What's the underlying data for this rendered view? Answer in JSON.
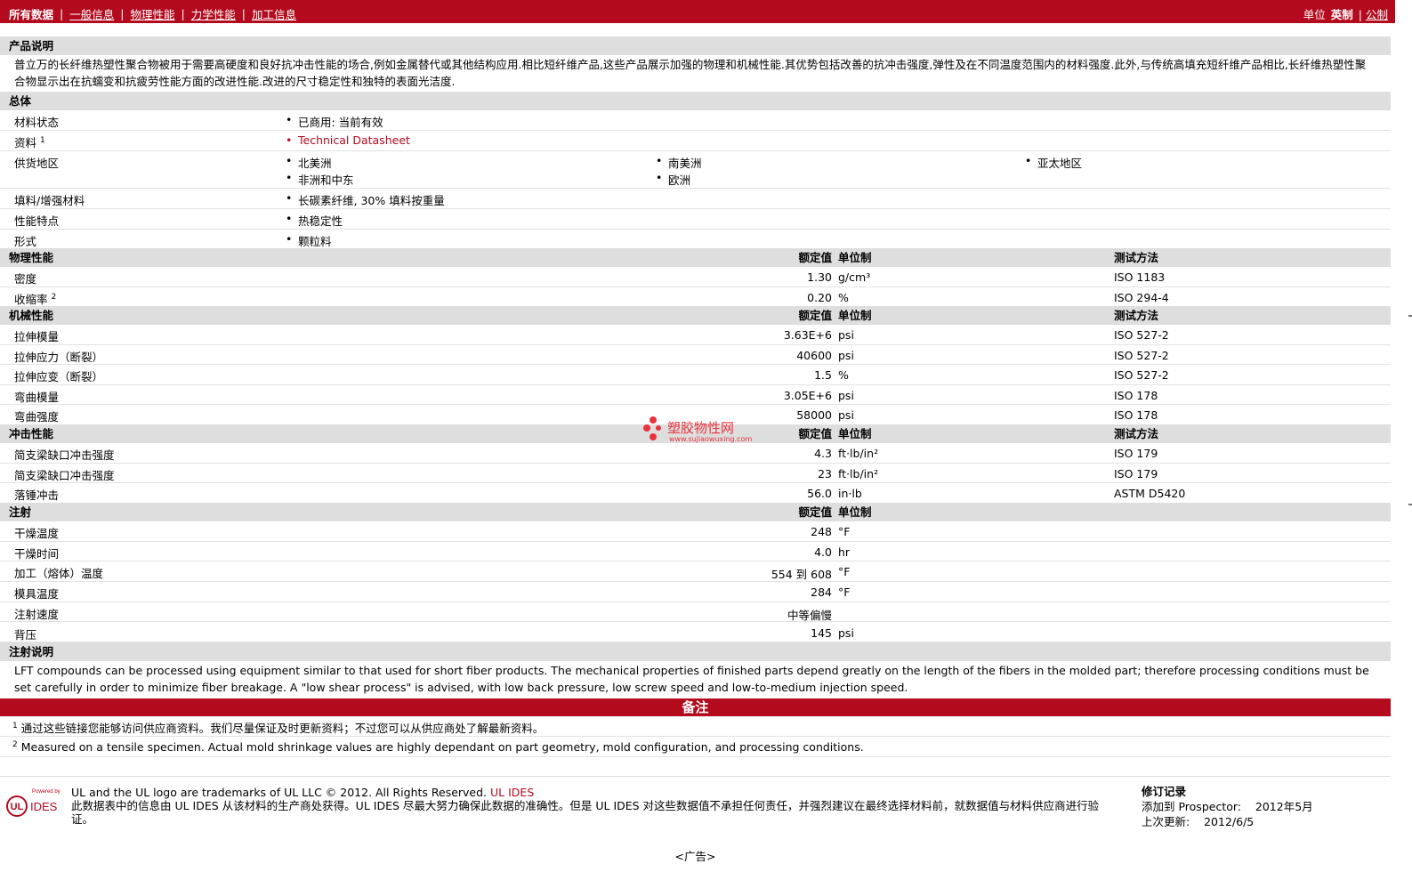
{
  "tabs": [
    "所有数据",
    "一般信息",
    "物理性能",
    "力学性能",
    "加工信息"
  ],
  "units": {
    "label": "单位",
    "current": "英制",
    "alternate": "公制"
  },
  "product": {
    "heading": "产品说明",
    "text": "普立万的长纤维热塑性聚合物被用于需要高硬度和良好抗冲击性能的场合,例如金属替代或其他结构应用.相比短纤维产品,这些产品展示加强的物理和机械性能.其优势包括改善的抗冲击强度,弹性及在不同温度范围内的材料强度.此外,与传统高填充短纤维产品相比,长纤维热塑性聚合物显示出在抗蠕变和抗疲劳性能方面的改进性能.改进的尺寸稳定性和独特的表面光洁度."
  },
  "general": {
    "heading": "总体",
    "status_label": "材料状态",
    "status_value": "已商用: 当前有效",
    "resource_label": "资料",
    "resource_sup": "1",
    "resource_value": "Technical Datasheet",
    "region_label": "供货地区",
    "regions": [
      "北美洲",
      "南美洲",
      "亚太地区",
      "非洲和中东",
      "欧洲"
    ],
    "filler_label": "填料/增强材料",
    "filler_value": "长碳素纤维, 30% 填料按重量",
    "feature_label": "性能特点",
    "feature_value": "热稳定性",
    "form_label": "形式",
    "form_value": "颗粒料"
  },
  "col_headers": {
    "value": "额定值",
    "unit": "单位制",
    "method": "测试方法"
  },
  "physical": {
    "heading": "物理性能",
    "rows": [
      {
        "label": "密度",
        "sup": "",
        "value": "1.30",
        "unit": "g/cm³",
        "method": "ISO 1183"
      },
      {
        "label": "收缩率",
        "sup": "2",
        "value": "0.20",
        "unit": "%",
        "method": "ISO 294-4"
      }
    ]
  },
  "mechanical": {
    "heading": "机械性能",
    "rows": [
      {
        "label": "拉伸模量",
        "value": "3.63E+6",
        "unit": "psi",
        "method": "ISO 527-2"
      },
      {
        "label": "拉伸应力（断裂）",
        "value": "40600",
        "unit": "psi",
        "method": "ISO 527-2"
      },
      {
        "label": "拉伸应变（断裂）",
        "value": "1.5",
        "unit": "%",
        "method": "ISO 527-2"
      },
      {
        "label": "弯曲模量",
        "value": "3.05E+6",
        "unit": "psi",
        "method": "ISO 178"
      },
      {
        "label": "弯曲强度",
        "value": "58000",
        "unit": "psi",
        "method": "ISO 178"
      }
    ]
  },
  "impact": {
    "heading": "冲击性能",
    "rows": [
      {
        "label": "简支梁缺口冲击强度",
        "value": "4.3",
        "unit": "ft·lb/in²",
        "method": "ISO 179"
      },
      {
        "label": "简支梁缺口冲击强度",
        "value": "23",
        "unit": "ft·lb/in²",
        "method": "ISO 179"
      },
      {
        "label": "落锤冲击",
        "value": "56.0",
        "unit": "in·lb",
        "method": "ASTM D5420"
      }
    ]
  },
  "injection": {
    "heading": "注射",
    "rows": [
      {
        "label": "干燥温度",
        "value": "248",
        "unit": "°F"
      },
      {
        "label": "干燥时间",
        "value": "4.0",
        "unit": "hr"
      },
      {
        "label": "加工（熔体）温度",
        "value": "554 到 608",
        "unit": "°F"
      },
      {
        "label": "模具温度",
        "value": "284",
        "unit": "°F"
      },
      {
        "label": "注射速度",
        "value": "中等偏慢",
        "unit": ""
      },
      {
        "label": "背压",
        "value": "145",
        "unit": "psi"
      }
    ]
  },
  "injection_notes": {
    "heading": "注射说明",
    "text": "LFT compounds can be processed using equipment similar to that used for short fiber products. The mechanical properties of finished parts depend greatly on the length of the fibers in the molded part; therefore processing conditions must be set carefully in order to minimize fiber breakage. A \"low shear process\" is advised, with low back pressure, low screw speed and low-to-medium injection speed."
  },
  "notes": {
    "heading": "备注",
    "n1_sup": "1",
    "n1": "通过这些链接您能够访问供应商资料。我们尽量保证及时更新资料；不过您可以从供应商处了解最新资料。",
    "n2_sup": "2",
    "n2": "Measured on a tensile specimen. Actual mold shrinkage values are highly dependant on part geometry, mold configuration, and processing conditions."
  },
  "watermark": {
    "name": "塑胶物性网",
    "url": "www.sujiaowuxing.com"
  },
  "footer": {
    "logo_powered": "Powered by",
    "logo_ul": "UL",
    "logo_ides": "IDES",
    "line1": "UL and the UL logo are trademarks of UL LLC © 2012. All Rights Reserved.",
    "line1_link": "UL IDES",
    "line2": "此数据表中的信息由 UL IDES 从该材料的生产商处获得。UL IDES 尽最大努力确保此数据的准确性。但是 UL IDES 对这些数据值不承担任何责任，并强烈建议在最终选择材料前，就数据值与材料供应商进行验",
    "line3": "证。",
    "rev_title": "修订记录",
    "rev_added": "添加到 Prospector:    2012年5月",
    "rev_updated": "上次更新:    2012/6/5"
  },
  "ad": "<广告>",
  "colors": {
    "brand": "#b30a1e",
    "section_bg": "#dedede"
  }
}
